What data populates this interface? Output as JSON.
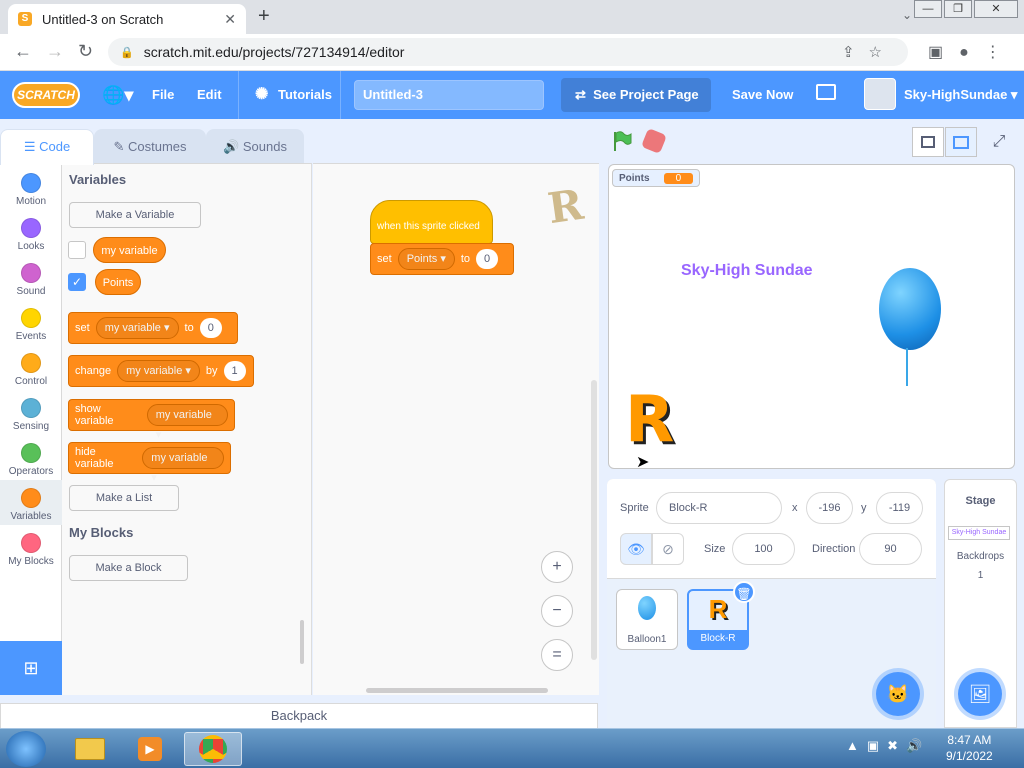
{
  "browser": {
    "tab_title": "Untitled-3 on Scratch",
    "tab_close": "✕",
    "new_tab": "+",
    "url": "scratch.mit.edu/projects/727134914/editor",
    "window_buttons": [
      "—",
      "❐",
      "✕"
    ]
  },
  "menubar": {
    "logo": "SCRATCH",
    "file": "File",
    "edit": "Edit",
    "tutorials": "Tutorials",
    "project_title": "Untitled-3",
    "see_project": "See Project Page",
    "save_now": "Save Now",
    "username": "Sky-HighSundae"
  },
  "editor_tabs": {
    "code": "Code",
    "costumes": "Costumes",
    "sounds": "Sounds"
  },
  "categories": [
    {
      "label": "Motion",
      "color": "#4c97ff"
    },
    {
      "label": "Looks",
      "color": "#9966ff"
    },
    {
      "label": "Sound",
      "color": "#cf63cf"
    },
    {
      "label": "Events",
      "color": "#ffd500"
    },
    {
      "label": "Control",
      "color": "#ffab19"
    },
    {
      "label": "Sensing",
      "color": "#5cb1d6"
    },
    {
      "label": "Operators",
      "color": "#59c059"
    },
    {
      "label": "Variables",
      "color": "#ff8c1a"
    },
    {
      "label": "My Blocks",
      "color": "#ff6680"
    }
  ],
  "flyout": {
    "variables_heading": "Variables",
    "make_variable": "Make a Variable",
    "var1": "my variable",
    "var2": "Points",
    "set_block": {
      "verb": "set",
      "var": "my variable",
      "prep": "to",
      "value": "0"
    },
    "change_block": {
      "verb": "change",
      "var": "my variable",
      "prep": "by",
      "value": "1"
    },
    "show_block": {
      "verb": "show variable",
      "var": "my variable"
    },
    "hide_block": {
      "verb": "hide variable",
      "var": "my variable"
    },
    "make_list": "Make a List",
    "myblocks_heading": "My Blocks",
    "make_block": "Make a Block"
  },
  "script": {
    "hat": "when this sprite clicked",
    "set_verb": "set",
    "set_var": "Points",
    "set_prep": "to",
    "set_value": "0"
  },
  "zoom": {
    "in": "+",
    "out": "−",
    "reset": "="
  },
  "backpack": "Backpack",
  "stage": {
    "monitor_label": "Points",
    "monitor_value": "0",
    "text": "Sky-High Sundae",
    "sprite_letter": "R"
  },
  "sprite_info": {
    "sprite_label": "Sprite",
    "sprite_name": "Block-R",
    "x_label": "x",
    "x_value": "-196",
    "y_label": "y",
    "y_value": "-119",
    "show_label": "Show",
    "size_label": "Size",
    "size_value": "100",
    "direction_label": "Direction",
    "direction_value": "90"
  },
  "sprites": [
    {
      "name": "Balloon1"
    },
    {
      "name": "Block-R"
    }
  ],
  "stage_pane": {
    "title": "Stage",
    "thumb_text": "Sky-High Sundae",
    "backdrops_label": "Backdrops",
    "backdrops_count": "1"
  },
  "taskbar": {
    "time": "8:47 AM",
    "date": "9/1/2022"
  }
}
